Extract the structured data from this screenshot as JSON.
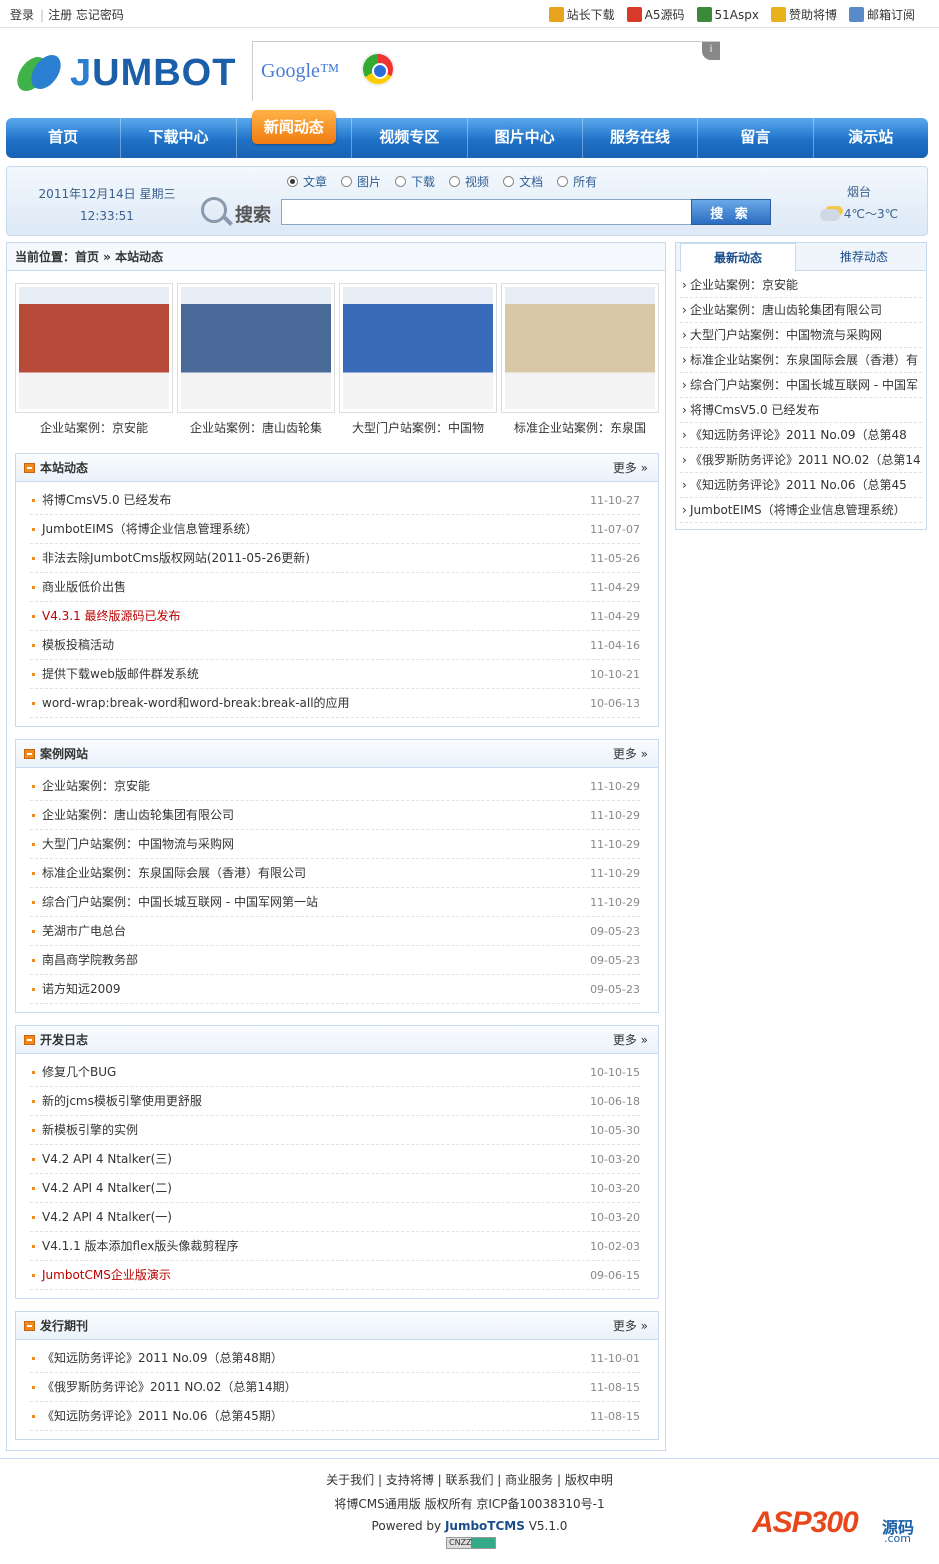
{
  "topbar": {
    "login": "登录",
    "register": "注册",
    "forgot": "忘记密码",
    "links": [
      {
        "label": "站长下载",
        "icon": "download-icon",
        "color": "#e8a21b"
      },
      {
        "label": "A5源码",
        "icon": "a5-icon",
        "color": "#d83a2a"
      },
      {
        "label": "51Aspx",
        "icon": "aspx-icon",
        "color": "#3a8a3a"
      },
      {
        "label": "赞助将博",
        "icon": "thumb-up-icon",
        "color": "#e8b21b"
      },
      {
        "label": "邮箱订阅",
        "icon": "mail-icon",
        "color": "#5a8ac8"
      }
    ]
  },
  "logo": {
    "text_j": "J",
    "text_rest": "UMBOT"
  },
  "ad": {
    "google": "Google™",
    "info": "i"
  },
  "nav": [
    "首页",
    "下载中心",
    "新闻动态",
    "视频专区",
    "图片中心",
    "服务在线",
    "留言",
    "演示站"
  ],
  "nav_active": 2,
  "search": {
    "date": "2011年12月14日  星期三",
    "time": "12:33:51",
    "label": "搜索",
    "options": [
      "文章",
      "图片",
      "下载",
      "视频",
      "文档",
      "所有"
    ],
    "selected": 0,
    "button": "搜 索",
    "placeholder": "",
    "city": "烟台",
    "temp": "4℃～3℃"
  },
  "breadcrumb": "当前位置：首页 » 本站动态",
  "thumbs": [
    {
      "caption": "企业站案例：京安能",
      "color": "#b84a3a"
    },
    {
      "caption": "企业站案例：唐山齿轮集",
      "color": "#4a6a9a"
    },
    {
      "caption": "大型门户站案例：中国物",
      "color": "#3a6aba"
    },
    {
      "caption": "标准企业站案例：东泉国",
      "color": "#d8c8a8"
    }
  ],
  "panels": [
    {
      "title": "本站动态",
      "more": "更多 »",
      "items": [
        {
          "t": "将博CmsV5.0 已经发布",
          "d": "11-10-27"
        },
        {
          "t": "JumbotEIMS（将博企业信息管理系统）",
          "d": "11-07-07"
        },
        {
          "t": "非法去除JumbotCms版权网站(2011-05-26更新)",
          "d": "11-05-26"
        },
        {
          "t": "商业版低价出售",
          "d": "11-04-29"
        },
        {
          "t": "V4.3.1 最终版源码已发布",
          "d": "11-04-29",
          "red": true
        },
        {
          "t": "模板投稿活动",
          "d": "11-04-16"
        },
        {
          "t": "提供下载web版邮件群发系统",
          "d": "10-10-21"
        },
        {
          "t": "word-wrap:break-word和word-break:break-all的应用",
          "d": "10-06-13"
        }
      ]
    },
    {
      "title": "案例网站",
      "more": "更多 »",
      "items": [
        {
          "t": "企业站案例：京安能",
          "d": "11-10-29"
        },
        {
          "t": "企业站案例：唐山齿轮集团有限公司",
          "d": "11-10-29"
        },
        {
          "t": "大型门户站案例：中国物流与采购网",
          "d": "11-10-29"
        },
        {
          "t": "标准企业站案例：东泉国际会展（香港）有限公司",
          "d": "11-10-29"
        },
        {
          "t": "综合门户站案例：中国长城互联网 - 中国军网第一站",
          "d": "11-10-29"
        },
        {
          "t": "芜湖市广电总台",
          "d": "09-05-23"
        },
        {
          "t": "南昌商学院教务部",
          "d": "09-05-23"
        },
        {
          "t": "诺方知远2009",
          "d": "09-05-23"
        }
      ]
    },
    {
      "title": "开发日志",
      "more": "更多 »",
      "items": [
        {
          "t": "修复几个BUG",
          "d": "10-10-15"
        },
        {
          "t": "新的jcms模板引擎使用更舒服",
          "d": "10-06-18"
        },
        {
          "t": "新模板引擎的实例",
          "d": "10-05-30"
        },
        {
          "t": "V4.2 API 4 Ntalker(三)",
          "d": "10-03-20"
        },
        {
          "t": "V4.2 API 4 Ntalker(二)",
          "d": "10-03-20"
        },
        {
          "t": "V4.2 API 4 Ntalker(一)",
          "d": "10-03-20"
        },
        {
          "t": "V4.1.1 版本添加flex版头像裁剪程序",
          "d": "10-02-03"
        },
        {
          "t": "JumbotCMS企业版演示",
          "d": "09-06-15",
          "red": true
        }
      ]
    },
    {
      "title": "发行期刊",
      "more": "更多 »",
      "items": [
        {
          "t": "《知远防务评论》2011 No.09（总第48期）",
          "d": "11-10-01"
        },
        {
          "t": "《俄罗斯防务评论》2011 NO.02（总第14期）",
          "d": "11-08-15"
        },
        {
          "t": "《知远防务评论》2011 No.06（总第45期）",
          "d": "11-08-15"
        }
      ]
    }
  ],
  "side": {
    "tab_on": "最新动态",
    "tab_off": "推荐动态",
    "items": [
      "企业站案例：京安能",
      "企业站案例：唐山齿轮集团有限公司",
      "大型门户站案例：中国物流与采购网",
      "标准企业站案例：东泉国际会展（香港）有",
      "综合门户站案例：中国长城互联网 - 中国军",
      "将博CmsV5.0 已经发布",
      "《知远防务评论》2011 No.09（总第48",
      "《俄罗斯防务评论》2011 NO.02（总第14",
      "《知远防务评论》2011 No.06（总第45",
      "JumbotEIMS（将博企业信息管理系统）"
    ]
  },
  "footer": {
    "links": "关于我们 | 支持将博 | 联系我们 | 商业服务 | 版权申明",
    "copy": "将博CMS通用版  版权所有  京ICP备10038310号-1",
    "powered": "Powered by",
    "brand": "JumboTCMS",
    "version": "V5.1.0",
    "badge": "CNZZ"
  },
  "watermark": {
    "w1": "ASP300",
    "w2": "源码",
    "w3": ".com"
  }
}
